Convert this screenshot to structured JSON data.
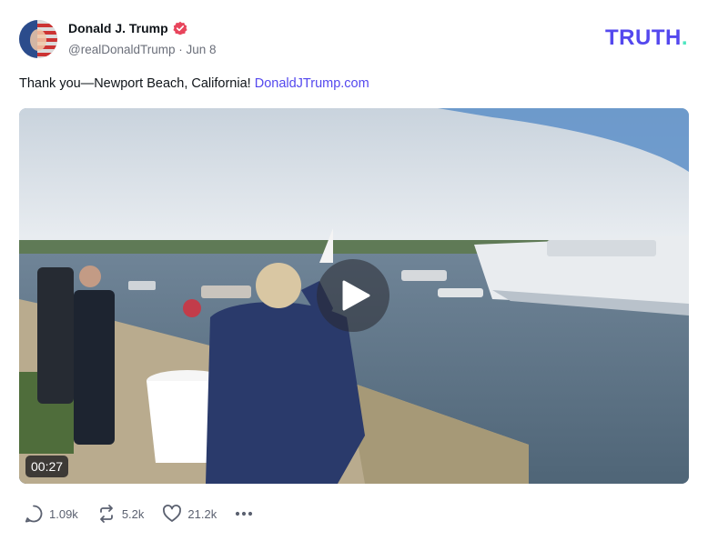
{
  "author": {
    "name": "Donald J. Trump",
    "handle": "@realDonaldTrump",
    "separator": "·",
    "date": "Jun 8"
  },
  "brand": {
    "logo_text": "TRUTH",
    "logo_dot": "."
  },
  "post": {
    "text": "Thank you—Newport Beach, California!",
    "link": "DonaldJTrump.com"
  },
  "video": {
    "duration": "00:27"
  },
  "actions": {
    "replies": "1.09k",
    "retruths": "5.2k",
    "likes": "21.2k"
  },
  "icons": {
    "verified": "verified-badge-icon",
    "play": "play-icon",
    "reply": "reply-icon",
    "retruth": "retruth-icon",
    "like": "heart-icon",
    "more": "more-icon"
  },
  "colors": {
    "brand": "#5448ee",
    "brand_dot": "#4ee6c0",
    "verified": "#e8455c",
    "muted": "#6b6f7a"
  }
}
